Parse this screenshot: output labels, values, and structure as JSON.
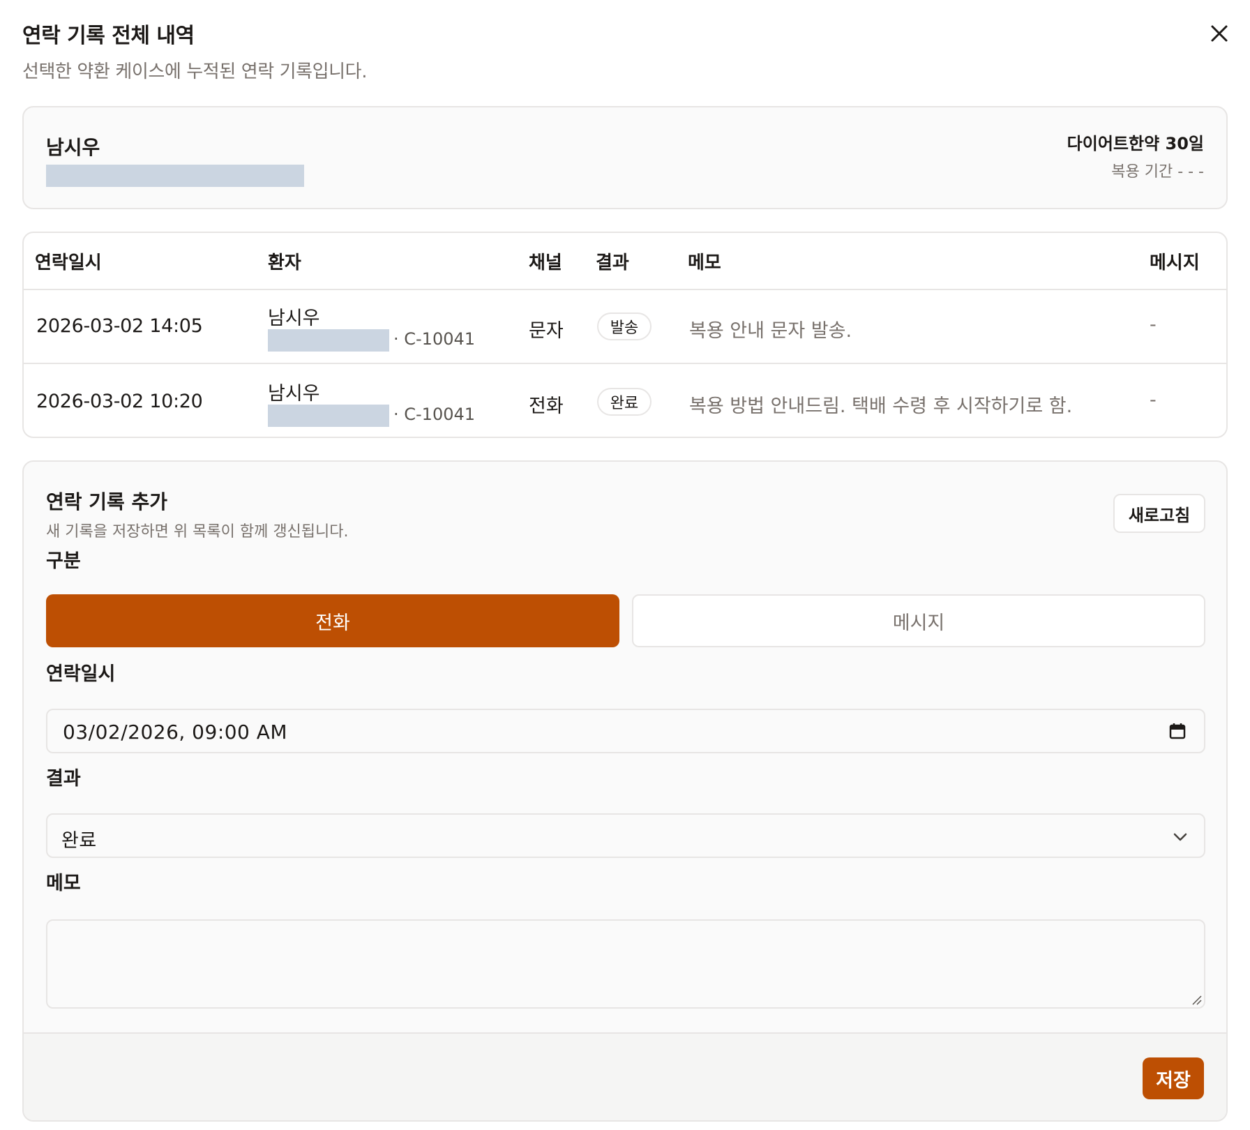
{
  "dialog": {
    "title": "연락 기록 전체 내역",
    "description": "선택한 약환 케이스에 누적된 연락 기록입니다."
  },
  "summary": {
    "patient_name": "남시우",
    "product": "다이어트한약 30일",
    "period": "복용 기간 - - -"
  },
  "table": {
    "headers": [
      "연락일시",
      "환자",
      "채널",
      "결과",
      "메모",
      "메시지"
    ],
    "rows": [
      {
        "datetime": "2026-03-02 14:05",
        "patient": "남시우",
        "patient_id": "· C-10041",
        "channel": "문자",
        "result": "발송",
        "memo": "복용 안내 문자 발송.",
        "message": "-"
      },
      {
        "datetime": "2026-03-02 10:20",
        "patient": "남시우",
        "patient_id": "· C-10041",
        "channel": "전화",
        "result": "완료",
        "memo": "복용 방법 안내드림. 택배 수령 후 시작하기로 함.",
        "message": "-"
      }
    ]
  },
  "add_record": {
    "title": "연락 기록 추가",
    "description": "새 기록을 저장하면 위 목록이 함께 갱신됩니다.",
    "refresh_label": "새로고침",
    "type_label": "구분",
    "type_options": [
      "전화",
      "메시지"
    ],
    "type_selected": "전화",
    "datetime_label": "연락일시",
    "datetime_value": "03/02/2026, 09:00 AM",
    "result_label": "결과",
    "result_value": "완료",
    "memo_label": "메모",
    "memo_value": "",
    "save_label": "저장"
  },
  "colors": {
    "accent": "#bd4f03",
    "border": "#e7e5e4",
    "redaction": "#cbd5e1",
    "muted_text": "#78716c"
  },
  "icons": [
    "close-icon",
    "calendar-icon",
    "chevron-down-icon",
    "resize-handle-icon"
  ]
}
